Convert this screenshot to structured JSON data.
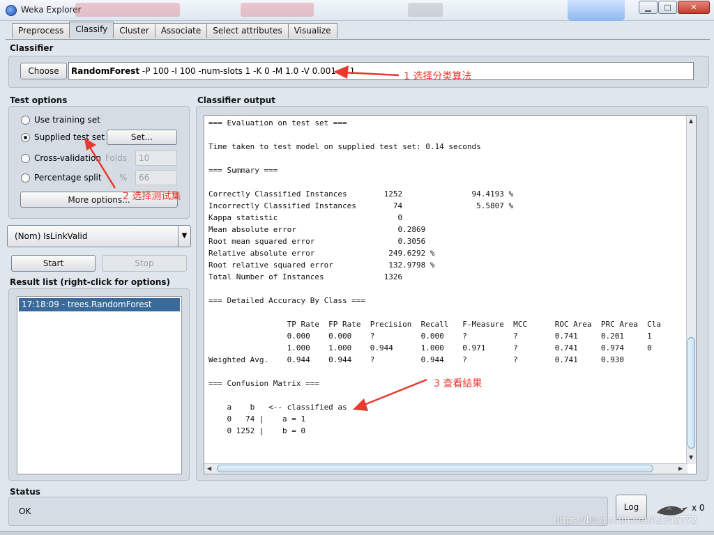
{
  "window": {
    "title": "Weka Explorer"
  },
  "tabs": [
    {
      "label": "Preprocess"
    },
    {
      "label": "Classify",
      "active": true
    },
    {
      "label": "Cluster"
    },
    {
      "label": "Associate"
    },
    {
      "label": "Select attributes"
    },
    {
      "label": "Visualize"
    }
  ],
  "classifier": {
    "section": "Classifier",
    "choose_label": "Choose",
    "name": "RandomForest",
    "options": " -P 100 -I 100 -num-slots 1 -K 0 -M 1.0 -V 0.001 -S 1"
  },
  "test_options": {
    "section": "Test options",
    "use_training": "Use training set",
    "supplied_test": "Supplied test set",
    "set_label": "Set...",
    "cross_validation": "Cross-validation",
    "folds_label": "Folds",
    "folds_value": "10",
    "percentage_split": "Percentage split",
    "percent_label": "%",
    "percent_value": "66",
    "more_options": "More options...",
    "selected": "supplied_test"
  },
  "class_selector": {
    "value": "(Nom) IsLinkValid"
  },
  "actions": {
    "start": "Start",
    "stop": "Stop"
  },
  "result_list": {
    "section": "Result list (right-click for options)",
    "items": [
      "17:18:09 - trees.RandomForest"
    ]
  },
  "output": {
    "section": "Classifier output",
    "lines": [
      "=== Evaluation on test set ===",
      "",
      "Time taken to test model on supplied test set: 0.14 seconds",
      "",
      "=== Summary ===",
      "",
      "Correctly Classified Instances        1252               94.4193 %",
      "Incorrectly Classified Instances        74                5.5807 %",
      "Kappa statistic                          0",
      "Mean absolute error                      0.2869",
      "Root mean squared error                  0.3056",
      "Relative absolute error                249.6292 %",
      "Root relative squared error            132.9798 %",
      "Total Number of Instances             1326",
      "",
      "=== Detailed Accuracy By Class ===",
      "",
      "                 TP Rate  FP Rate  Precision  Recall   F-Measure  MCC      ROC Area  PRC Area  Cla",
      "                 0.000    0.000    ?          0.000    ?          ?        0.741     0.201     1",
      "                 1.000    1.000    0.944      1.000    0.971      ?        0.741     0.974     0",
      "Weighted Avg.    0.944    0.944    ?          0.944    ?          ?        0.741     0.930",
      "",
      "=== Confusion Matrix ===",
      "",
      "    a    b   <-- classified as",
      "    0   74 |    a = 1",
      "    0 1252 |    b = 0"
    ]
  },
  "annotations": {
    "a1": "1 选择分类算法",
    "a2": "2 选择测试集",
    "a3": "3 查看结果"
  },
  "status": {
    "section": "Status",
    "text": "OK",
    "log_label": "Log",
    "count": "x 0"
  },
  "watermark": "https://blog.csdn.net/A1342772",
  "colors": {
    "annotation": "#e8382f",
    "selection": "#3a6a9a"
  }
}
